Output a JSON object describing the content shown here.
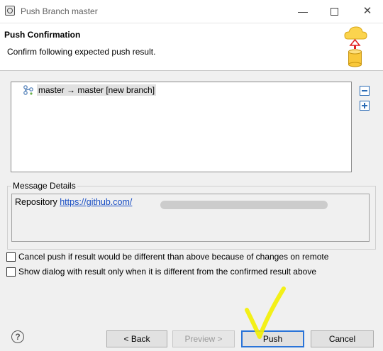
{
  "window": {
    "title": "Push Branch master"
  },
  "header": {
    "title": "Push Confirmation",
    "description": "Confirm following expected push result."
  },
  "result_tree": {
    "items": [
      {
        "label": "master → master [new branch]"
      }
    ]
  },
  "message_details": {
    "group_label": "Message Details",
    "repository_label": "Repository",
    "repository_url": "https://github.com/"
  },
  "options": {
    "cancel_if_different": "Cancel push if result would be different than above because of changes on remote",
    "show_only_if_different": "Show dialog with result only when it is different from the confirmed result above"
  },
  "buttons": {
    "help": "?",
    "back": "< Back",
    "preview": "Preview >",
    "push": "Push",
    "cancel": "Cancel"
  },
  "colors": {
    "link": "#1a4fc4",
    "focus_border": "#2a74d8",
    "annotation": "#f3f000"
  }
}
